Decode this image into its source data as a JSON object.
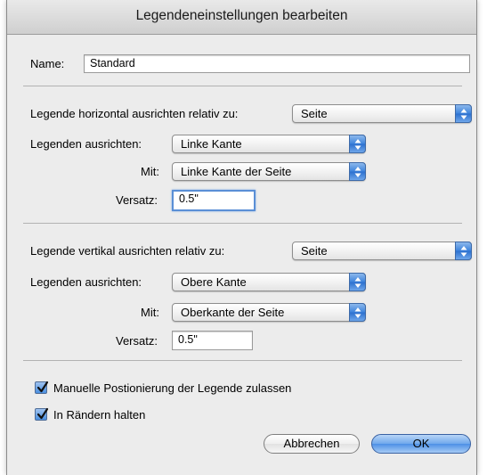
{
  "dialog": {
    "title": "Legendeneinstellungen bearbeiten"
  },
  "name": {
    "label": "Name:",
    "value": "Standard"
  },
  "horizontal": {
    "relative_label": "Legende horizontal ausrichten relativ zu:",
    "relative_value": "Seite",
    "align_label": "Legenden ausrichten:",
    "align_value": "Linke Kante",
    "with_label": "Mit:",
    "with_value": "Linke Kante der Seite",
    "offset_label": "Versatz:",
    "offset_value": "0.5\""
  },
  "vertical": {
    "relative_label": "Legende vertikal ausrichten relativ zu:",
    "relative_value": "Seite",
    "align_label": "Legenden ausrichten:",
    "align_value": "Obere Kante",
    "with_label": "Mit:",
    "with_value": "Oberkante der Seite",
    "offset_label": "Versatz:",
    "offset_value": "0.5\""
  },
  "options": {
    "manual_label": "Manuelle Postionierung der Legende zulassen",
    "manual_checked": true,
    "margins_label": "In Rändern halten",
    "margins_checked": true
  },
  "buttons": {
    "cancel": "Abbrechen",
    "ok": "OK"
  },
  "colors": {
    "accent": "#4d90e6",
    "window": "#ececec"
  }
}
